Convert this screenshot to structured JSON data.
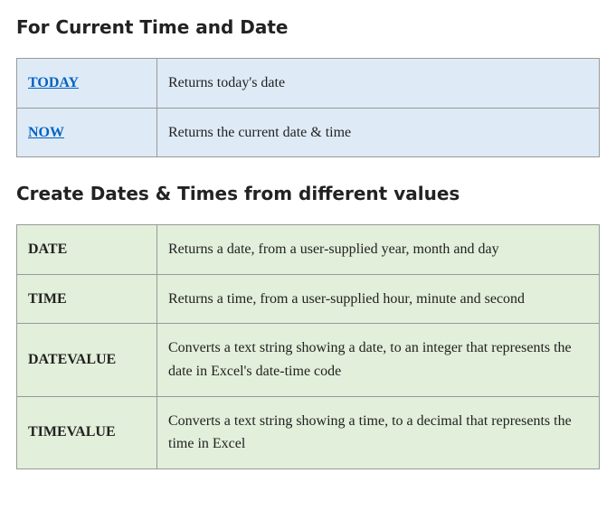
{
  "section1": {
    "heading": "For Current Time and Date",
    "rows": [
      {
        "fn": "TODAY",
        "desc": "Returns today's date"
      },
      {
        "fn": "NOW",
        "desc": "Returns the current date & time"
      }
    ]
  },
  "section2": {
    "heading": "Create Dates & Times from different values",
    "rows": [
      {
        "fn": "DATE",
        "desc": "Returns a date, from a user-supplied year, month and day"
      },
      {
        "fn": "TIME",
        "desc": "Returns a time, from a user-supplied hour, minute and second"
      },
      {
        "fn": "DATEVALUE",
        "desc": "Converts a text string showing a date, to an integer that represents the   date in Excel's date-time code"
      },
      {
        "fn": "TIMEVALUE",
        "desc": "Converts a text string showing a time, to a decimal that represents the time in Excel"
      }
    ]
  }
}
